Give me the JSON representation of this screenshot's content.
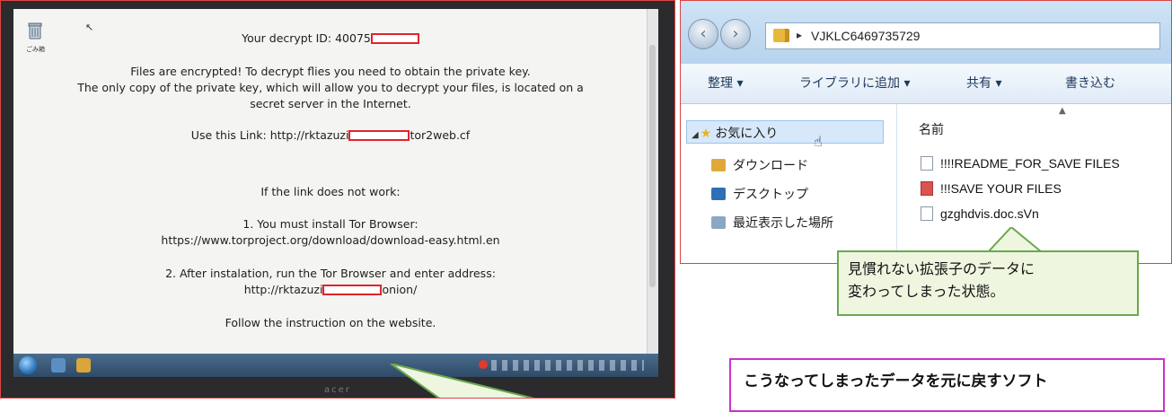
{
  "ransom_note": {
    "bin_label": "ごみ箱",
    "decrypt_id": "Your decrypt ID: 40075",
    "line1": "Files are encrypted! To decrypt flies you need to obtain the private key.",
    "line2": "The only copy of the private key, which will allow you to decrypt your files, is located on a",
    "line3": "secret server in the Internet.",
    "link_prefix": "Use this Link: http://rktazuzi",
    "link_suffix": "tor2web.cf",
    "if_not_work": "If the link does not work:",
    "step1": "1. You must install Tor Browser:",
    "step1_url": "https://www.torproject.org/download/download-easy.html.en",
    "step2": "2. After instalation, run the Tor Browser and enter address:",
    "onion_prefix": "http://rktazuzi",
    "onion_suffix": "onion/",
    "follow": "Follow the instruction on the website."
  },
  "explorer": {
    "address": "VJKLC6469735729",
    "toolbar": [
      "整理 ▾",
      "ライブラリに追加 ▾",
      "共有 ▾",
      "書き込む"
    ],
    "nav": [
      "お気に入り",
      "ダウンロード",
      "デスクトップ",
      "最近表示した場所"
    ],
    "column_header": "名前",
    "files": [
      "!!!!README_FOR_SAVE FILES",
      "!!!SAVE YOUR FILES",
      "gzghdvis.doc.sVn"
    ]
  },
  "callouts": {
    "extension_note_line1": "見慣れない拡張子のデータに",
    "extension_note_line2": "変わってしまった状態。",
    "software_note": "こうなってしまったデータを元に戻すソフト"
  },
  "colors": {
    "redact_border": "#e0242b",
    "callout_green_border": "#6aa84f",
    "callout_pink_border": "#cc33cc"
  }
}
